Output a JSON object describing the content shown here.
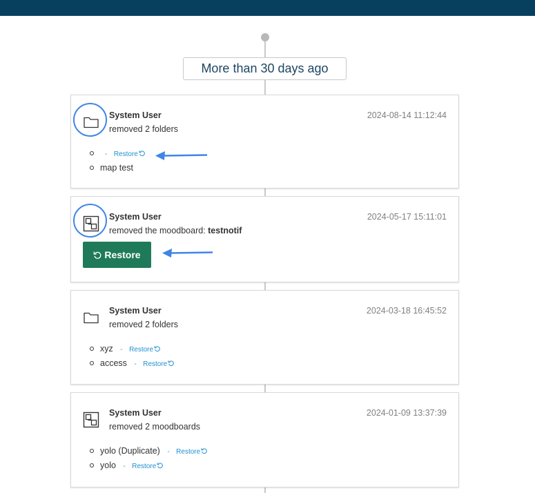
{
  "colors": {
    "header": "#073f5e",
    "restore_button": "#1f7a5a",
    "link": "#1f8fd0",
    "annotation": "#3f85e6"
  },
  "timeline": {
    "period_label": "More than 30 days ago"
  },
  "activities": [
    {
      "icon": "folder-icon",
      "user": "System User",
      "action": "removed 2 folders",
      "timestamp": "2024-08-14 11:12:44",
      "items": [
        {
          "name": "",
          "separator": "-",
          "restore_label": "Restore"
        },
        {
          "name": "map test"
        }
      ]
    },
    {
      "icon": "moodboard-icon",
      "user": "System User",
      "action": "removed the moodboard: ",
      "action_target": "testnotif",
      "timestamp": "2024-05-17 15:11:01",
      "restore_button_label": "Restore"
    },
    {
      "icon": "folder-icon",
      "user": "System User",
      "action": "removed 2 folders",
      "timestamp": "2024-03-18 16:45:52",
      "items": [
        {
          "name": "xyz",
          "separator": "-",
          "restore_label": "Restore"
        },
        {
          "name": "access",
          "separator": "-",
          "restore_label": "Restore"
        }
      ]
    },
    {
      "icon": "moodboard-icon",
      "user": "System User",
      "action": "removed 2 moodboards",
      "timestamp": "2024-01-09 13:37:39",
      "items": [
        {
          "name": "yolo (Duplicate)",
          "separator": "-",
          "restore_label": "Restore"
        },
        {
          "name": "yolo",
          "separator": "-",
          "restore_label": "Restore"
        }
      ]
    }
  ]
}
